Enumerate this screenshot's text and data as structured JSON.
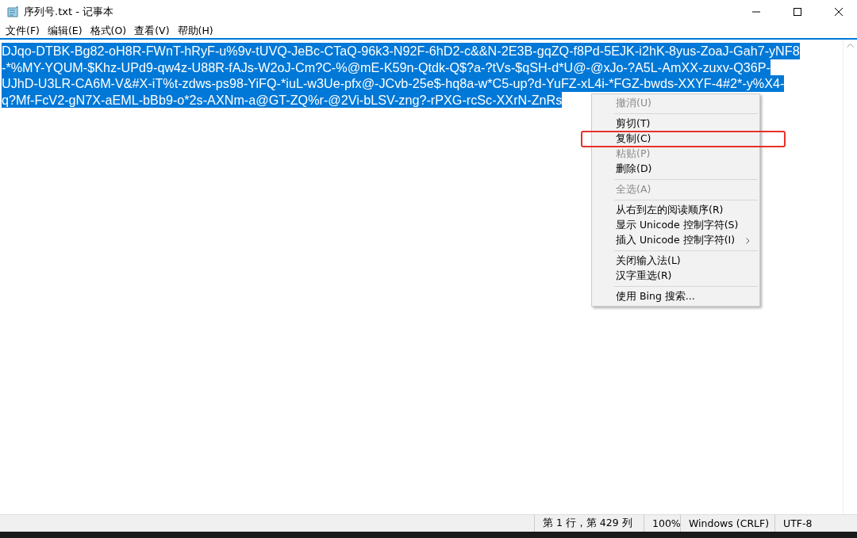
{
  "window": {
    "title": "序列号.txt - 记事本"
  },
  "menu_bar": [
    {
      "label": "文件(F)"
    },
    {
      "label": "编辑(E)"
    },
    {
      "label": "格式(O)"
    },
    {
      "label": "查看(V)"
    },
    {
      "label": "帮助(H)"
    }
  ],
  "editor": {
    "selected": true,
    "lines": [
      "DJqo-DTBK-Bg82-oH8R-FWnT-hRyF-u%9v-tUVQ-JeBc-CTaQ-96k3-N92F-6hD2-c&&N-2E3B-gqZQ-f8Pd-5EJK-i2hK-8yus-ZoaJ-Gah7-yNF8",
      "-*%MY-YQUM-$Khz-UPd9-qw4z-U88R-fAJs-W2oJ-Cm?C-%@mE-K59n-Qtdk-Q$?a-?tVs-$qSH-d*U@-@xJo-?A5L-AmXX-zuxv-Q36P-",
      "UJhD-U3LR-CA6M-V&#X-iT%t-zdws-ps98-YiFQ-*iuL-w3Ue-pfx@-JCvb-25e$-hq8a-w*C5-up?d-YuFZ-xL4i-*FGZ-bwds-XXYF-4#2*-y%X4-",
      "q?Mf-FcV2-gN7X-aEML-bBb9-o*2s-AXNm-a@GT-ZQ%r-@2Vi-bLSV-zng?-rPXG-rcSc-XXrN-ZnRs"
    ]
  },
  "context_menu": [
    {
      "kind": "item",
      "label": "撤消(U)",
      "disabled": true,
      "annotated": false,
      "submenu": false
    },
    {
      "kind": "separator"
    },
    {
      "kind": "item",
      "label": "剪切(T)",
      "disabled": false,
      "annotated": false,
      "submenu": false
    },
    {
      "kind": "item",
      "label": "复制(C)",
      "disabled": false,
      "annotated": true,
      "submenu": false
    },
    {
      "kind": "item",
      "label": "粘贴(P)",
      "disabled": true,
      "annotated": false,
      "submenu": false
    },
    {
      "kind": "item",
      "label": "删除(D)",
      "disabled": false,
      "annotated": false,
      "submenu": false
    },
    {
      "kind": "separator"
    },
    {
      "kind": "item",
      "label": "全选(A)",
      "disabled": true,
      "annotated": false,
      "submenu": false
    },
    {
      "kind": "separator"
    },
    {
      "kind": "item",
      "label": "从右到左的阅读顺序(R)",
      "disabled": false,
      "annotated": false,
      "submenu": false
    },
    {
      "kind": "item",
      "label": "显示 Unicode 控制字符(S)",
      "disabled": false,
      "annotated": false,
      "submenu": false
    },
    {
      "kind": "item",
      "label": "插入 Unicode 控制字符(I)",
      "disabled": false,
      "annotated": false,
      "submenu": true
    },
    {
      "kind": "separator"
    },
    {
      "kind": "item",
      "label": "关闭输入法(L)",
      "disabled": false,
      "annotated": false,
      "submenu": false
    },
    {
      "kind": "item",
      "label": "汉字重选(R)",
      "disabled": false,
      "annotated": false,
      "submenu": false
    },
    {
      "kind": "separator"
    },
    {
      "kind": "item",
      "label": "使用 Bing 搜索...",
      "disabled": false,
      "annotated": false,
      "submenu": false
    }
  ],
  "status_bar": [
    "第 1 行，第 429 列",
    "100%",
    "Windows (CRLF)",
    "UTF-8"
  ]
}
